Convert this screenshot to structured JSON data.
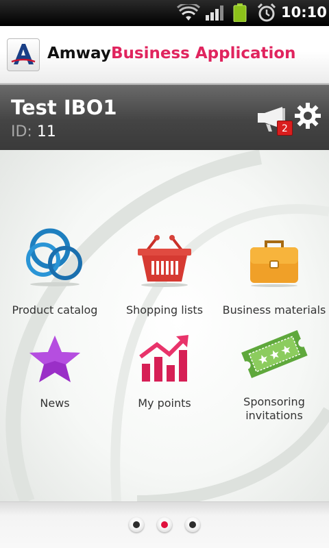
{
  "status_bar": {
    "time": "10:10",
    "icons": [
      "wifi-icon",
      "signal-icon",
      "battery-icon",
      "alarm-icon"
    ]
  },
  "header": {
    "brand": "Amway",
    "title": "Business Application",
    "logo_letter": "A",
    "title_color": "#e0245e"
  },
  "user": {
    "name": "Test IBO1",
    "id_label": "ID:",
    "id_value": "11",
    "notification_count": "2"
  },
  "tiles": [
    {
      "label": "Product catalog",
      "icon": "rings-icon"
    },
    {
      "label": "Shopping lists",
      "icon": "basket-icon"
    },
    {
      "label": "Business materials",
      "icon": "briefcase-icon"
    },
    {
      "label": "News",
      "icon": "star-icon"
    },
    {
      "label": "My points",
      "icon": "bar-chart-icon"
    },
    {
      "label": "Sponsoring invitations",
      "label_lines": [
        "Sponsoring",
        "invitations"
      ],
      "icon": "ticket-icon"
    }
  ],
  "pager": {
    "pages": 3,
    "current": 2,
    "active_color": "#e0103d"
  }
}
